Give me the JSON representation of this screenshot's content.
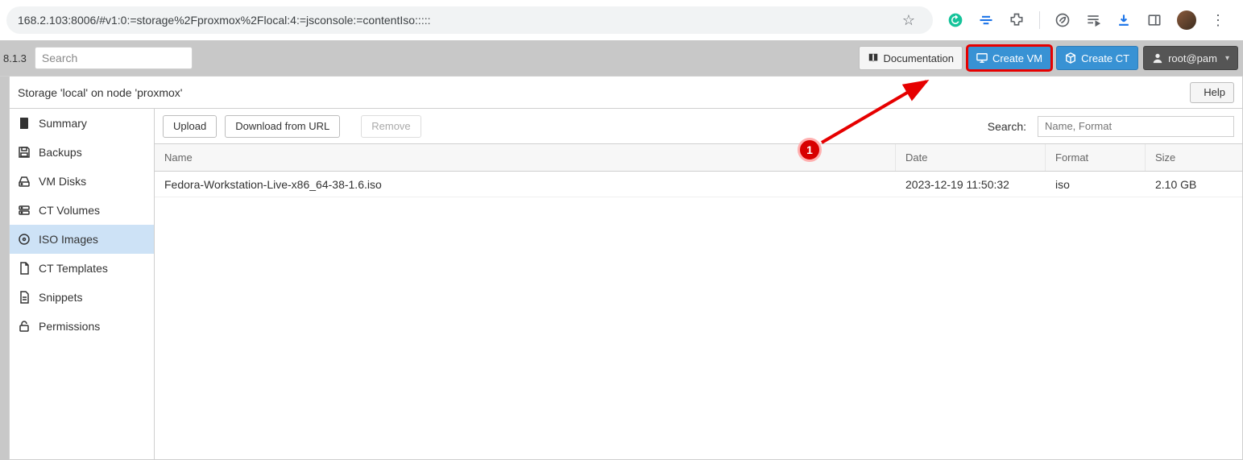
{
  "browser": {
    "url": "168.2.103:8006/#v1:0:=storage%2Fproxmox%2Flocal:4:=jsconsole:=contentIso:::::"
  },
  "top": {
    "version": "8.1.3",
    "search_placeholder": "Search",
    "documentation": "Documentation",
    "create_vm": "Create VM",
    "create_ct": "Create CT",
    "user": "root@pam"
  },
  "header": {
    "title": "Storage 'local' on node 'proxmox'",
    "help": "Help"
  },
  "sidebar": {
    "items": [
      {
        "label": "Summary"
      },
      {
        "label": "Backups"
      },
      {
        "label": "VM Disks"
      },
      {
        "label": "CT Volumes"
      },
      {
        "label": "ISO Images"
      },
      {
        "label": "CT Templates"
      },
      {
        "label": "Snippets"
      },
      {
        "label": "Permissions"
      }
    ],
    "active_index": 4
  },
  "toolbar": {
    "upload": "Upload",
    "download_url": "Download from URL",
    "remove": "Remove",
    "search_label": "Search:",
    "search_placeholder": "Name, Format"
  },
  "grid": {
    "headers": {
      "name": "Name",
      "date": "Date",
      "format": "Format",
      "size": "Size"
    },
    "rows": [
      {
        "name": "Fedora-Workstation-Live-x86_64-38-1.6.iso",
        "date": "2023-12-19 11:50:32",
        "format": "iso",
        "size": "2.10 GB"
      }
    ]
  },
  "annotation": {
    "number": "1"
  }
}
